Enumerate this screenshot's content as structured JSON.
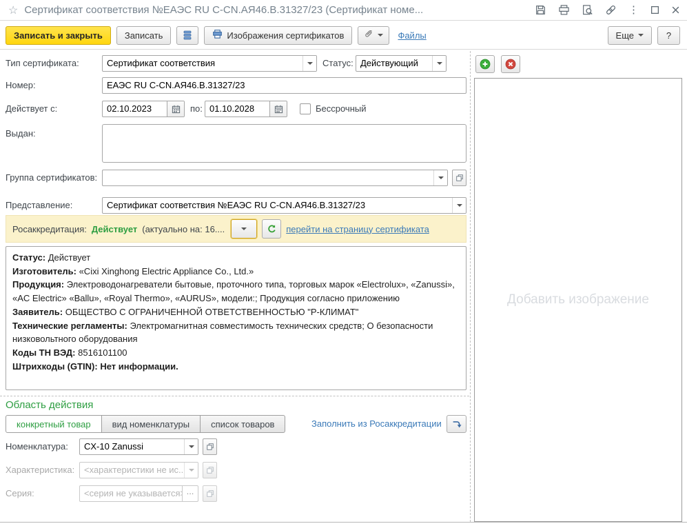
{
  "window": {
    "title": "Сертификат соответствия №ЕАЭС RU C-CN.АЯ46.В.31327/23 (Сертификат номе...",
    "star_icon": "☆",
    "kebab_icon": "⋮",
    "maximize_icon": "❒",
    "close_icon": "×"
  },
  "toolbar": {
    "save_close": "Записать и закрыть",
    "save": "Записать",
    "images": "Изображения сертификатов",
    "files": "Файлы",
    "more": "Еще",
    "help": "?"
  },
  "form": {
    "type_label": "Тип сертификата:",
    "type_value": "Сертификат соответствия",
    "status_label": "Статус:",
    "status_value": "Действующий",
    "number_label": "Номер:",
    "number_value": "ЕАЭС RU C-CN.АЯ46.В.31327/23",
    "valid_from_label": "Действует с:",
    "valid_from": "02.10.2023",
    "valid_to_label": "по:",
    "valid_to": "01.10.2028",
    "perpetual_label": "Бессрочный",
    "issued_label": "Выдан:",
    "issued_value": "",
    "group_label": "Группа сертификатов:",
    "group_value": "",
    "presentation_label": "Представление:",
    "presentation_value": "Сертификат соответствия №ЕАЭС RU C-CN.АЯ46.В.31327/23"
  },
  "accreditation": {
    "label": "Росаккредитация:",
    "status": "Действует",
    "note": "(актуально на: 16....",
    "link": "перейти на страницу сертификата"
  },
  "details": {
    "rows": [
      {
        "label": "Статус:",
        "text": " Действует"
      },
      {
        "label": "Изготовитель:",
        "text": " «Cixi Xinghong Electric Appliance Co., Ltd.»"
      },
      {
        "label": "Продукция:",
        "text": " Электроводонагреватели бытовые, проточного типа, торговых марок «Electrolux», «Zanussi», «AC Electric» «Ballu», «Royal Thermo», «AURUS», модели:; Продукция согласно приложению"
      },
      {
        "label": "Заявитель:",
        "text": " ОБЩЕСТВО С ОГРАНИЧЕННОЙ ОТВЕТСТВЕННОСТЬЮ \"Р-КЛИМАТ\""
      },
      {
        "label": "Технические регламенты:",
        "text": " Электромагнитная совместимость технических средств; О безопасности низковольтного оборудования"
      },
      {
        "label": "Коды ТН ВЭД:",
        "text": " 8516101100"
      },
      {
        "label": "Штрихкоды (GTIN):",
        "text": " Нет информации."
      }
    ]
  },
  "scope": {
    "title": "Область действия",
    "tabs": [
      {
        "label": "конкретный товар",
        "active": true
      },
      {
        "label": "вид номенклатуры",
        "active": false
      },
      {
        "label": "список товаров",
        "active": false
      }
    ],
    "fill_link": "Заполнить из Росаккредитации",
    "nomenclature_label": "Номенклатура:",
    "nomenclature_value": "CX-10 Zanussi",
    "characteristic_label": "Характеристика:",
    "characteristic_placeholder": "<характеристики не ис...",
    "series_label": "Серия:",
    "series_placeholder": "<серия не указывается>",
    "series_more": "...",
    "ellipsis_button": "..."
  },
  "image_panel": {
    "placeholder": "Добавить изображение"
  },
  "colors": {
    "accent_yellow": "#ffd60f",
    "band_bg": "#fbf2cb",
    "green": "#2e9e42",
    "link_blue": "#3b7ab8",
    "danger_red": "#d2473e",
    "success_green": "#3bae3b",
    "title_gray": "#76838e"
  }
}
